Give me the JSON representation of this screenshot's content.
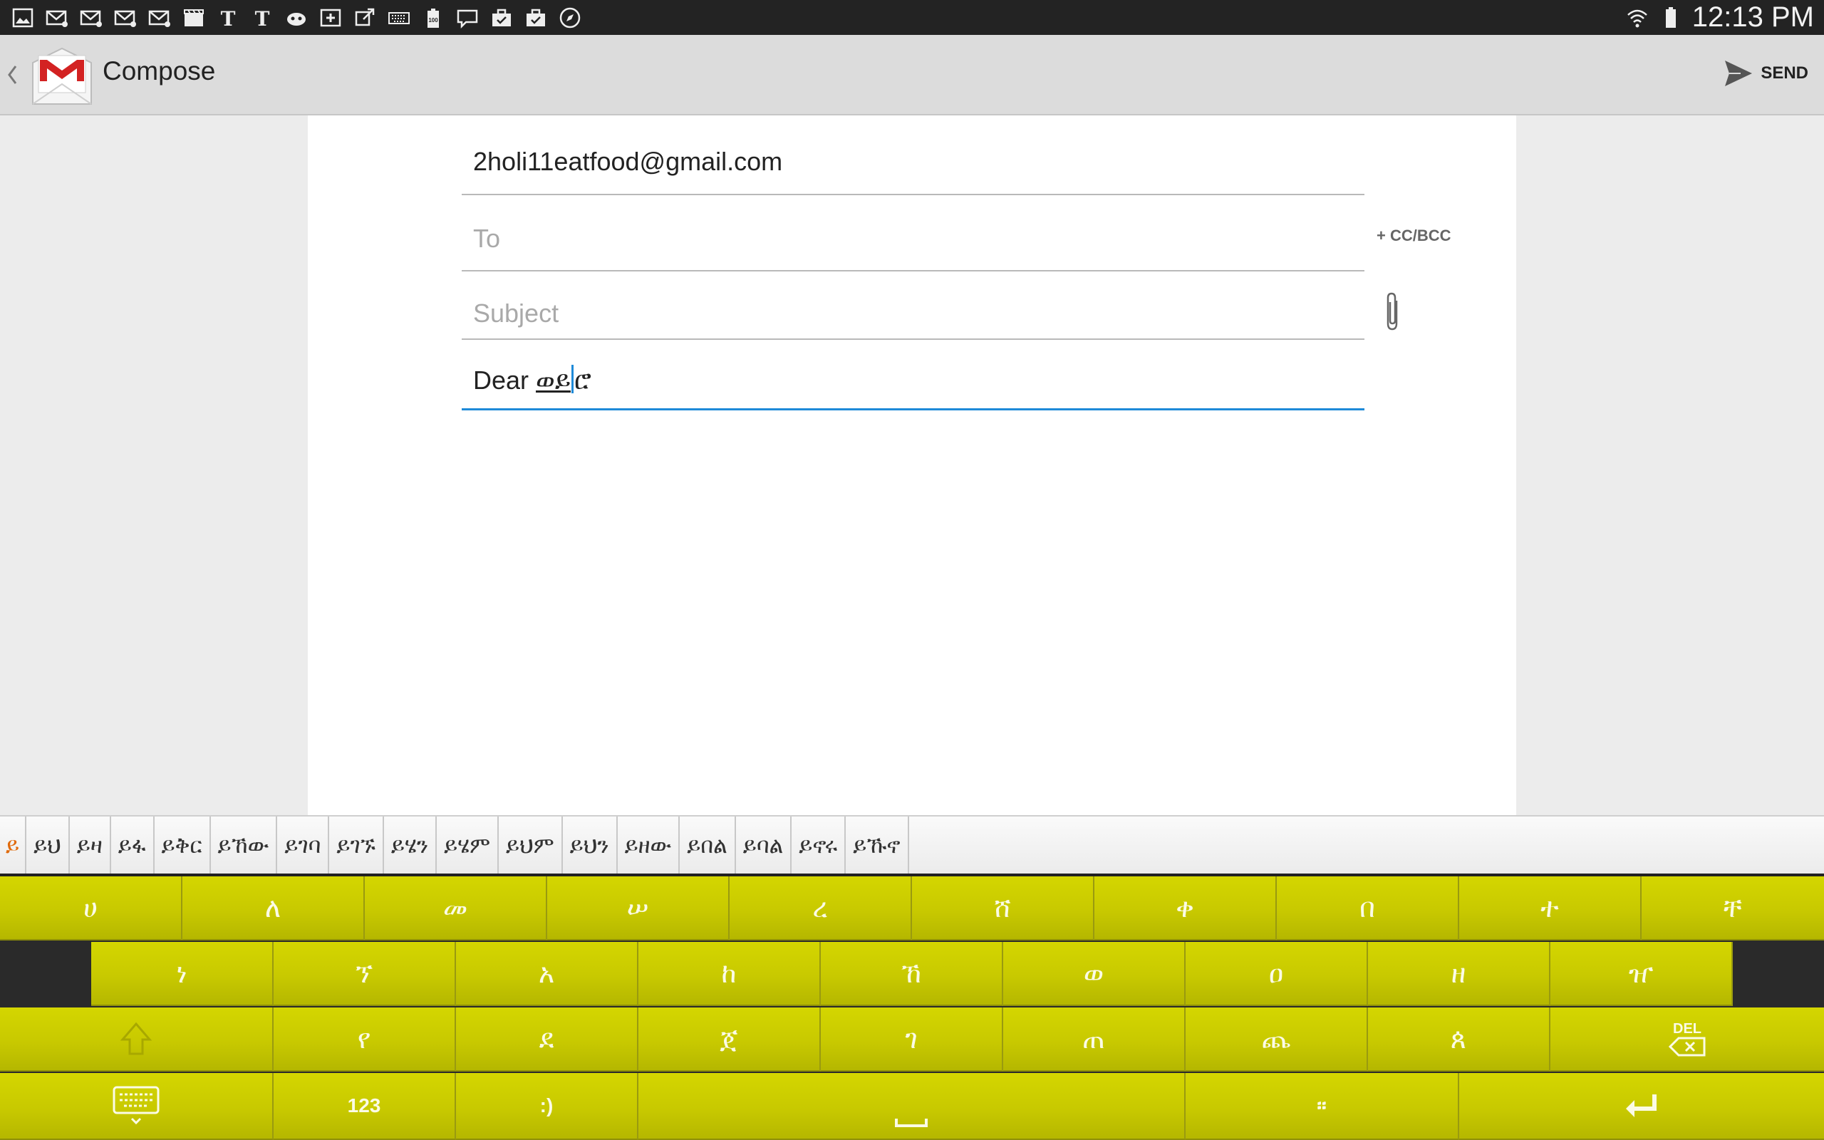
{
  "status_bar": {
    "time": "12:13 PM",
    "notification_icons": [
      "gallery-icon",
      "mail-icon",
      "mail-icon",
      "mail-icon",
      "mail-icon",
      "movie-icon",
      "news-icon",
      "news-icon",
      "gamepad-icon",
      "plus-box-icon",
      "share-icon",
      "keyboard-icon",
      "battery-100-icon",
      "message-icon",
      "briefcase-icon",
      "briefcase-check-icon",
      "compass-icon"
    ]
  },
  "action_bar": {
    "title": "Compose",
    "send_label": "SEND"
  },
  "compose": {
    "from": "2holi11eatfood@gmail.com",
    "to_placeholder": "To",
    "cc_bcc": "+ CC/BCC",
    "subject_placeholder": "Subject",
    "body_prefix": "Dear ",
    "body_composing_before_cursor": "ወይ",
    "body_composing_after_cursor": "ሮ"
  },
  "suggestions": [
    "ይ",
    "ይህ",
    "ይዛ",
    "ይፋ",
    "ይቅር",
    "ይኸው",
    "ይገባ",
    "ይገኙ",
    "ይሄን",
    "ይሄም",
    "ይህም",
    "ይህን",
    "ይዘው",
    "ይበል",
    "ይባል",
    "ይኖሩ",
    "ይኹኖ"
  ],
  "keyboard": {
    "row1": [
      "ሀ",
      "ለ",
      "መ",
      "ሠ",
      "ረ",
      "ሸ",
      "ቀ",
      "በ",
      "ተ",
      "ቸ"
    ],
    "row2": [
      "ነ",
      "ኘ",
      "አ",
      "ከ",
      "ኸ",
      "ወ",
      "ዐ",
      "ዘ",
      "ዠ"
    ],
    "row3": [
      "የ",
      "ደ",
      "ጀ",
      "ገ",
      "ጠ",
      "ጨ",
      "ጰ"
    ],
    "del_label": "DEL",
    "numbers_label": "123",
    "emoji_label": ":)",
    "ethiopic_punct_label": "፡፡"
  },
  "colors": {
    "key_yellow": "#c8c900",
    "status_bar": "#232323",
    "action_bar": "#dcdcdc",
    "cursor_blue": "#1e8ad8",
    "suggestion_active": "#e06a0c"
  }
}
